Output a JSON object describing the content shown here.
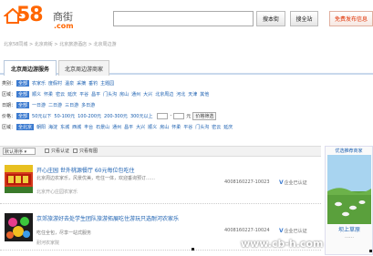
{
  "header": {
    "logo_number": "58",
    "logo_text": "商街",
    "logo_domain": ".com",
    "search_value": "",
    "search_button": "搜本街",
    "search_all_button": "搜全站",
    "publish_button": "免费发布信息"
  },
  "breadcrumb": "北京58同城 > 北京商街 > 北京旅游酒店 > 北京周边游",
  "tabs": [
    {
      "label": "北京周边游服务"
    },
    {
      "label": "北京周边游商家"
    }
  ],
  "filters": {
    "category": {
      "label": "类别：",
      "selected": "全部",
      "options": [
        "农家乐",
        "度假村",
        "温泉",
        "采摘",
        "垂钓",
        "主题园"
      ]
    },
    "area": {
      "label": "区域：",
      "selected": "全部",
      "options": [
        "顺义",
        "怀柔",
        "密云",
        "延庆",
        "平谷",
        "昌平",
        "门头沟",
        "房山",
        "通州",
        "大兴",
        "北京周边",
        "河北",
        "天津",
        "其他"
      ]
    },
    "date": {
      "label": "日期：",
      "selected": "全部",
      "options": [
        "一日游",
        "二日游",
        "三日游",
        "多日游"
      ]
    },
    "price": {
      "label": "价格：",
      "selected": "全部",
      "options": [
        "50元以下",
        "50-100元",
        "100-200元",
        "200-300元",
        "300元以上"
      ],
      "range_separator": "-",
      "range_unit": "元",
      "confirm": "价格筛选"
    },
    "region": {
      "label": "区域：",
      "selected": "全北京",
      "options": [
        "朝阳",
        "海淀",
        "东城",
        "西城",
        "丰台",
        "石景山",
        "通州",
        "昌平",
        "大兴",
        "顺义",
        "房山",
        "怀柔",
        "平谷",
        "门头沟",
        "密云",
        "延庆"
      ]
    }
  },
  "sortbar": {
    "select_value": "默认排序",
    "checkbox1": "只看认证",
    "checkbox2": "只看有图"
  },
  "listings": [
    {
      "title": "开心庄园 世外桃源餐厅 60元每位包吃住",
      "desc": "北京周边农家乐，风景优美，吃住一体，欢迎垂询预订……",
      "tags": "北京开心庄园农家乐",
      "phone": "4008160227-10023",
      "cert": "企业已认证"
    },
    {
      "title": "京郊旅游好去处学生团队旅游拓展吃住游玩只选耐河农家乐",
      "desc": "吃住全包，尽享一站式服务",
      "tags": "耐河农家院",
      "phone": "4008160227-10024",
      "cert": "企业已认证"
    }
  ],
  "side": {
    "title": "优选推荐商家",
    "caption": "坝上草原",
    "sub": "……"
  },
  "watermark": "www.cb-h.com",
  "colors": {
    "brand_orange": "#ff6600",
    "link_blue": "#1a5fb0",
    "selected_blue": "#3c7bd0"
  }
}
